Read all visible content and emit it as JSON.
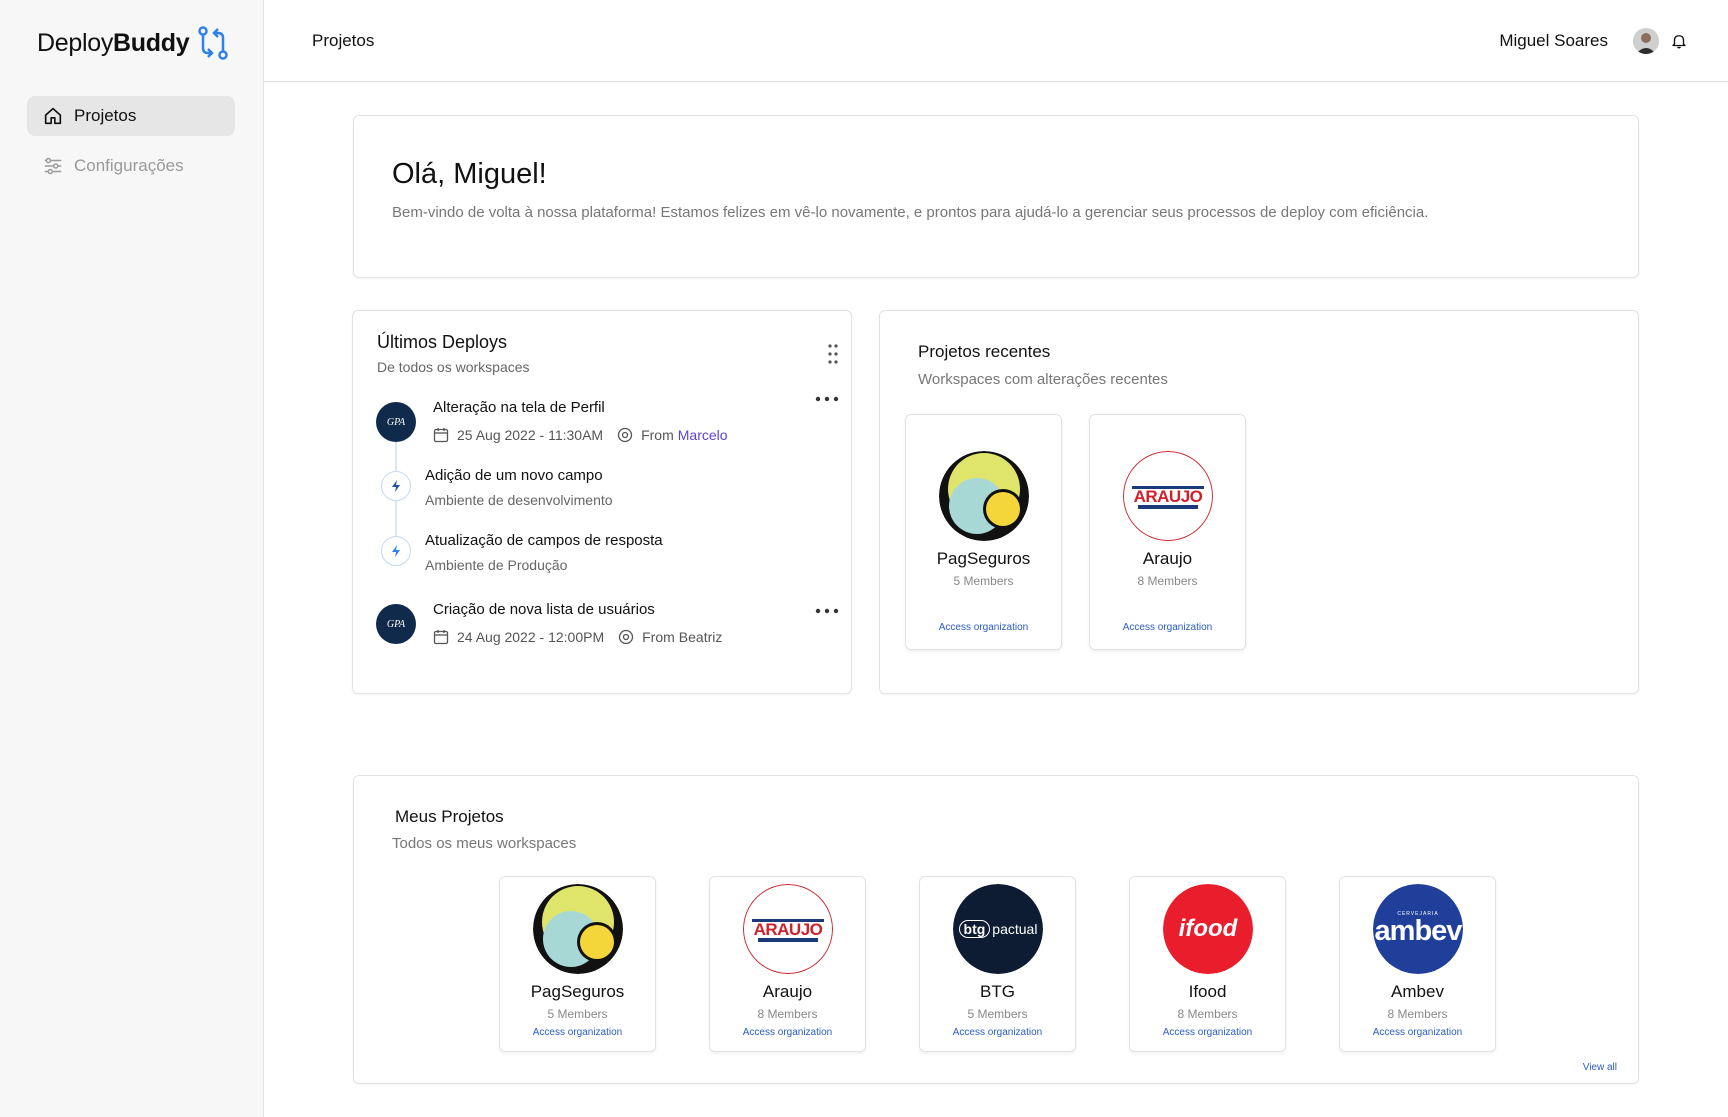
{
  "app": {
    "brand_light": "Deploy",
    "brand_bold": "Buddy",
    "accent": "#2f80ed"
  },
  "sidebar": {
    "items": [
      {
        "label": "Projetos",
        "icon": "home-icon",
        "active": true
      },
      {
        "label": "Configurações",
        "icon": "sliders-icon",
        "active": false
      }
    ]
  },
  "header": {
    "title": "Projetos",
    "user_name": "Miguel Soares"
  },
  "welcome": {
    "title": "Olá, Miguel!",
    "text": "Bem-vindo de volta à nossa plataforma! Estamos felizes em vê-lo novamente, e prontos para ajudá-lo a gerenciar seus processos de deploy com eficiência."
  },
  "deploys": {
    "title": "Últimos Deploys",
    "subtitle": "De todos os workspaces",
    "items": [
      {
        "logo": "GPA",
        "title": "Alteração na tela de Perfil",
        "date": "25 Aug 2022 - 11:30AM",
        "from_label": "From",
        "from_name": "Marcelo"
      },
      {
        "title": "Adição de um novo campo",
        "subtitle": "Ambiente de desenvolvimento"
      },
      {
        "title": "Atualização de campos de resposta",
        "subtitle": "Ambiente de Produção"
      },
      {
        "logo": "GPA",
        "title": "Criação de nova lista de usuários",
        "date": "24 Aug 2022 - 12:00PM",
        "from_label": "From",
        "from_name": "Beatriz"
      }
    ]
  },
  "recent": {
    "title": "Projetos recentes",
    "subtitle": "Workspaces com alterações recentes",
    "orgs": [
      {
        "name": "PagSeguros",
        "members": "5 Members",
        "access": "Access organization"
      },
      {
        "name": "Araujo",
        "members": "8 Members",
        "access": "Access organization",
        "logo_text": "ARAUJO"
      }
    ]
  },
  "projects": {
    "title": "Meus Projetos",
    "subtitle": "Todos os meus workspaces",
    "view_all": "View all",
    "orgs": [
      {
        "name": "PagSeguros",
        "members": "5 Members",
        "access": "Access organization"
      },
      {
        "name": "Araujo",
        "members": "8 Members",
        "access": "Access organization",
        "logo_text": "ARAUJO"
      },
      {
        "name": "BTG",
        "members": "5 Members",
        "access": "Access organization",
        "logo_b": "btg",
        "logo_rest": "pactual"
      },
      {
        "name": "Ifood",
        "members": "8 Members",
        "access": "Access organization",
        "logo_text": "ifood"
      },
      {
        "name": "Ambev",
        "members": "8 Members",
        "access": "Access organization",
        "logo_small": "CERVEJARIA",
        "logo_text": "ambev"
      }
    ]
  }
}
